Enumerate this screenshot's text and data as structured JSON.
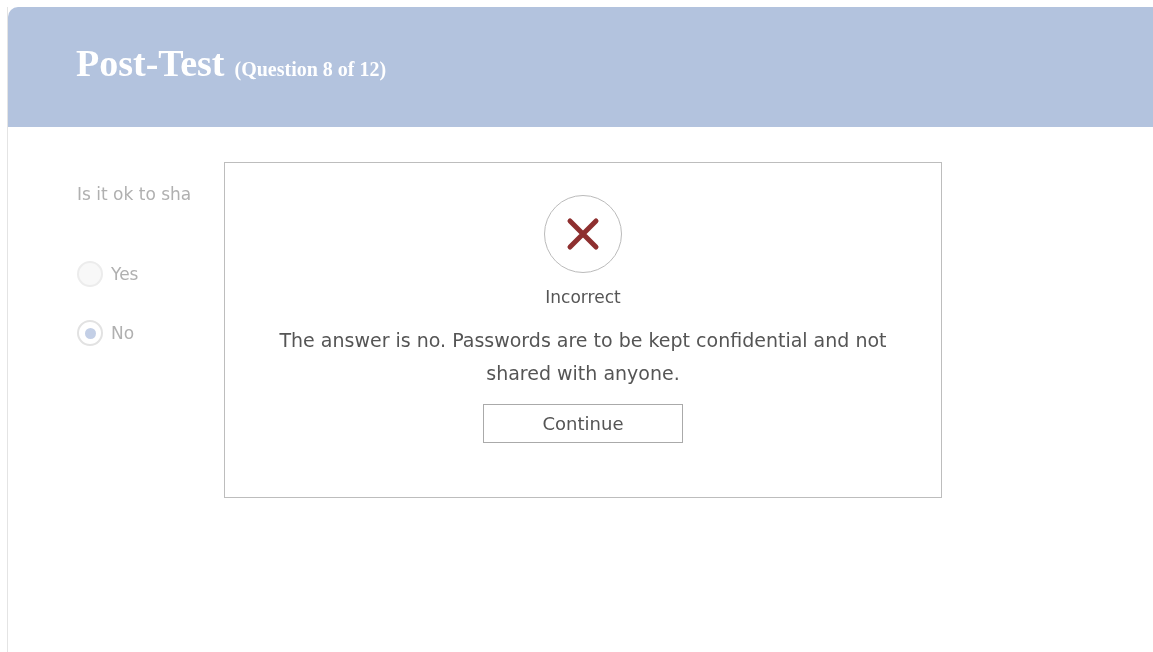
{
  "header": {
    "title": "Post-Test",
    "subtitle": "(Question 8 of 12)"
  },
  "question": {
    "text": "Is it ok to sha",
    "options": [
      {
        "label": "Yes",
        "selected": false
      },
      {
        "label": "No",
        "selected": true
      }
    ]
  },
  "dialog": {
    "status": "Incorrect",
    "message": "The answer is no. Passwords are to be kept confidential and not shared with anyone.",
    "button": "Continue"
  }
}
